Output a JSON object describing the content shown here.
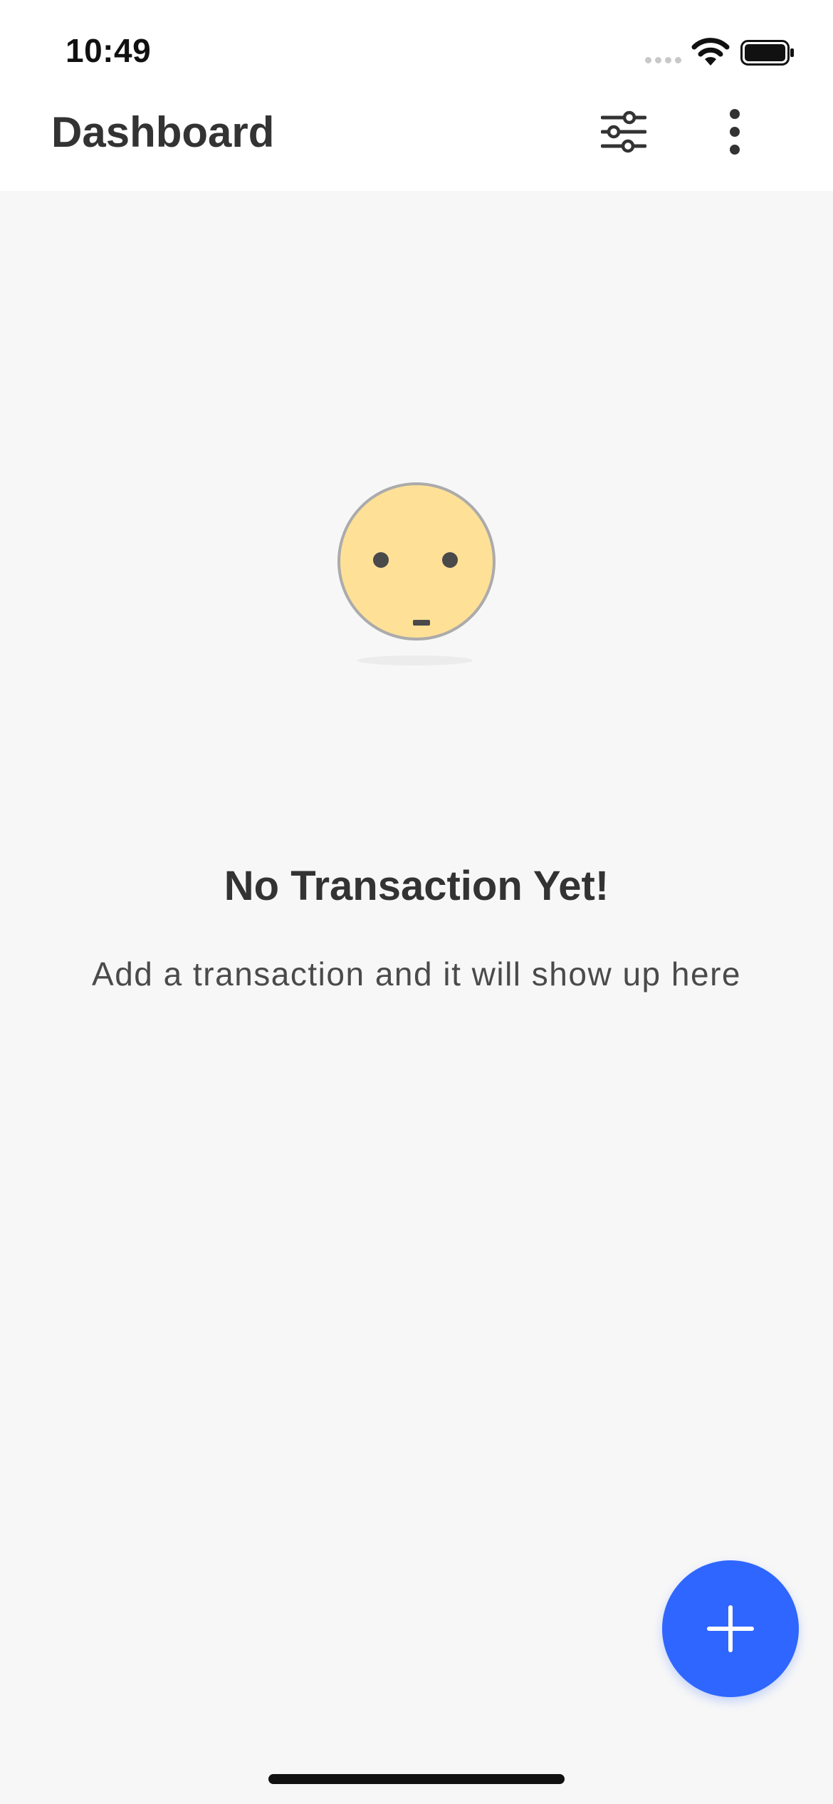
{
  "status_bar": {
    "time": "10:49",
    "icons": [
      "signal-icon",
      "wifi-icon",
      "battery-icon"
    ]
  },
  "app_bar": {
    "title": "Dashboard",
    "actions": [
      "filter-sliders-icon",
      "more-vertical-icon"
    ]
  },
  "empty_state": {
    "illustration": "neutral-face-icon",
    "title": "No Transaction Yet!",
    "subtitle": "Add a transaction and it will show up here"
  },
  "fab": {
    "icon": "plus-icon"
  },
  "colors": {
    "background": "#f7f7f7",
    "app_bar": "#ffffff",
    "accent": "#2f66ff",
    "face_fill": "#fee097",
    "text_primary": "#333333"
  }
}
